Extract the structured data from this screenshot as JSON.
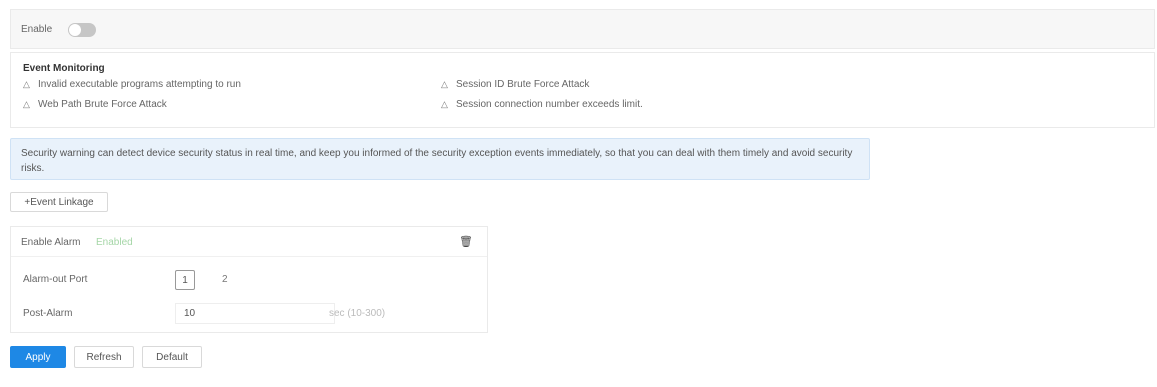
{
  "enable": {
    "label": "Enable",
    "state": "off"
  },
  "event_monitoring": {
    "title": "Event Monitoring",
    "items": [
      "Invalid executable programs attempting to run",
      "Web Path Brute Force Attack",
      "Session ID Brute Force Attack",
      "Session connection number exceeds limit."
    ]
  },
  "info": {
    "text": "Security warning can detect device security status in real time, and keep you informed of the security exception events immediately, so that you can deal with them timely and avoid security risks."
  },
  "event_linkage": {
    "button_label": "+Event Linkage",
    "enable_alarm_label": "Enable Alarm",
    "enabled_status": "Enabled",
    "alarm_out_label": "Alarm-out Port",
    "ports": [
      "1",
      "2"
    ],
    "post_alarm_label": "Post-Alarm",
    "post_alarm_value": "10",
    "post_alarm_hint": "sec (10-300)"
  },
  "actions": {
    "apply": "Apply",
    "refresh": "Refresh",
    "default": "Default"
  },
  "colors": {
    "accent": "#1e88e5",
    "info_bg": "#e9f2fb",
    "enabled": "#a5d6a7"
  }
}
